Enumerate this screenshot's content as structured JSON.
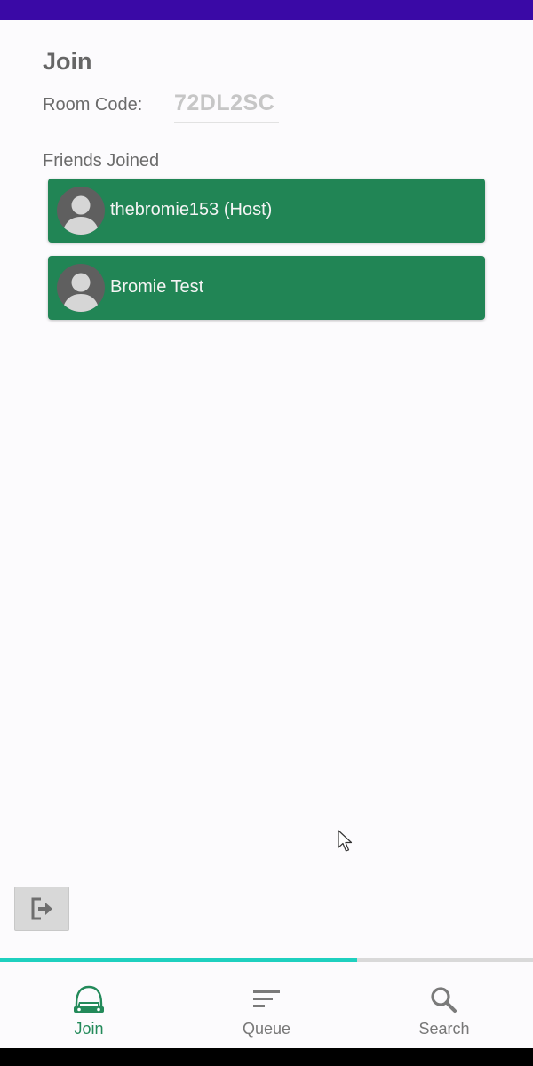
{
  "header": {
    "title": "Join"
  },
  "room": {
    "label": "Room Code:",
    "code": "72DL2SC"
  },
  "friends": {
    "label": "Friends Joined",
    "items": [
      {
        "name": "thebromie153 (Host)"
      },
      {
        "name": "Bromie Test"
      }
    ]
  },
  "progress": {
    "percent": 67
  },
  "nav": {
    "items": [
      {
        "label": "Join",
        "icon": "car-icon",
        "active": true
      },
      {
        "label": "Queue",
        "icon": "queue-icon",
        "active": false
      },
      {
        "label": "Search",
        "icon": "search-icon",
        "active": false
      }
    ]
  },
  "icons": {
    "leave": "exit-icon",
    "avatar": "person-icon"
  },
  "colors": {
    "status_bar": "#3a09a6",
    "card": "#218555",
    "accent": "#238a5a",
    "progress": "#1fd0bf"
  }
}
